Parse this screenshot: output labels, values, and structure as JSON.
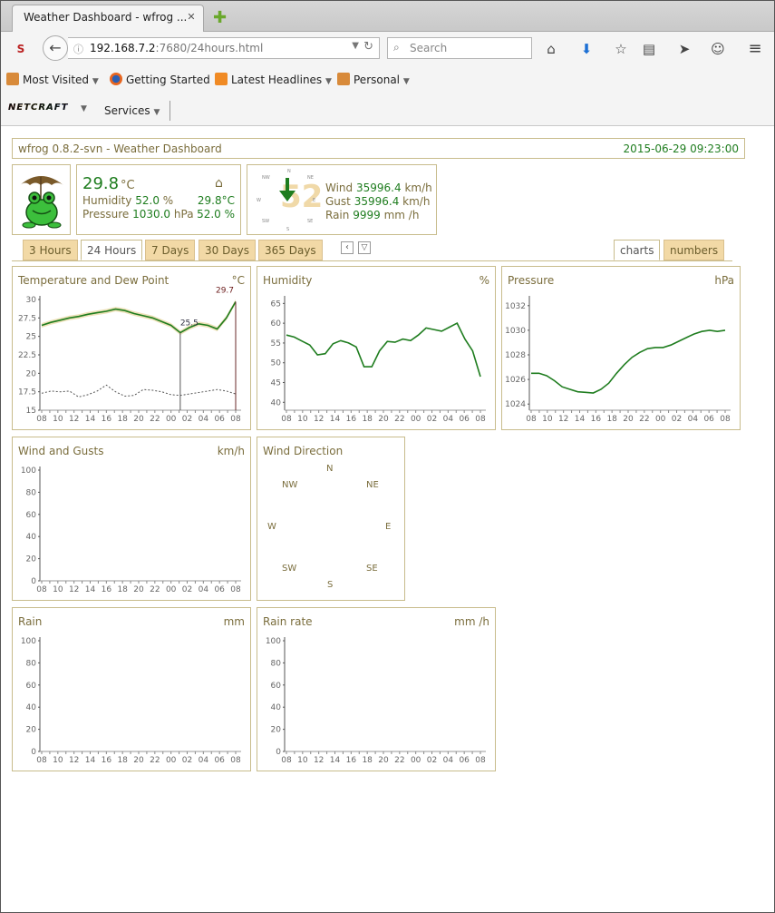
{
  "browser": {
    "tab_title": "Weather Dashboard - wfrog ...",
    "url_host": "192.168.7.2",
    "url_rest": ":7680/24hours.html",
    "search_placeholder": "Search",
    "bookmarks": [
      "Most Visited",
      "Getting Started",
      "Latest Headlines",
      "Personal"
    ],
    "netcraft_label": "NETCRAFT",
    "services_label": "Services"
  },
  "header": {
    "app_title": "wfrog 0.8.2-svn - Weather Dashboard",
    "datetime": "2015-06-29 09:23:00"
  },
  "current": {
    "temp": "29.8",
    "temp_unit": "°C",
    "humidity_label": "Humidity",
    "humidity": "52.0",
    "humidity_unit": "%",
    "pressure_label": "Pressure",
    "pressure": "1030.0",
    "pressure_unit": "hPa",
    "indoor_temp": "29.8°C",
    "indoor_hum": "52.0 %",
    "wind_label": "Wind",
    "wind": "35996.4",
    "wind_unit": "km/h",
    "gust_label": "Gust",
    "gust": "35996.4",
    "gust_unit": "km/h",
    "rain_label": "Rain",
    "rain": "9999",
    "rain_unit": "mm /h",
    "compass_value": "52"
  },
  "tabs": {
    "periods": [
      "3 Hours",
      "24 Hours",
      "7 Days",
      "30 Days",
      "365 Days"
    ],
    "active_period": "24 Hours",
    "views": [
      "charts",
      "numbers"
    ],
    "active_view": "charts"
  },
  "x_ticks": [
    "08",
    "10",
    "12",
    "14",
    "16",
    "18",
    "20",
    "22",
    "00",
    "02",
    "04",
    "06",
    "08"
  ],
  "compass_labels": {
    "N": "N",
    "NE": "NE",
    "E": "E",
    "SE": "SE",
    "S": "S",
    "SW": "SW",
    "W": "W",
    "NW": "NW"
  },
  "chart_data": [
    {
      "type": "line",
      "title": "Temperature and Dew Point",
      "unit": "°C",
      "ylim": [
        15,
        30
      ],
      "yticks": [
        "30",
        "27.5",
        "25",
        "22.5",
        "20",
        "17.5",
        "15"
      ],
      "series": [
        {
          "name": "temperature",
          "values": [
            26.5,
            26.9,
            27.2,
            27.5,
            27.7,
            28.0,
            28.2,
            28.4,
            28.7,
            28.5,
            28.1,
            27.8,
            27.5,
            27.0,
            26.5,
            25.5,
            26.2,
            26.7,
            26.5,
            26.0,
            27.5,
            29.7
          ]
        },
        {
          "name": "dew point",
          "values": [
            17.3,
            17.6,
            17.5,
            17.6,
            16.8,
            17.1,
            17.6,
            18.4,
            17.5,
            16.9,
            17.0,
            17.8,
            17.7,
            17.5,
            17.1,
            17.0,
            17.2,
            17.4,
            17.6,
            17.8,
            17.6,
            17.2
          ]
        }
      ],
      "annotations": [
        "25.5",
        "29.7"
      ]
    },
    {
      "type": "line",
      "title": "Humidity",
      "unit": "%",
      "ylim": [
        38,
        66
      ],
      "yticks": [
        "65",
        "60",
        "55",
        "50",
        "45",
        "40"
      ],
      "series": [
        {
          "name": "humidity",
          "values": [
            57,
            56.5,
            55.5,
            54.5,
            52,
            52.3,
            54.8,
            55.6,
            55,
            54,
            49,
            49,
            53,
            55.4,
            55.2,
            56,
            55.6,
            57,
            58.8,
            58.4,
            58,
            59,
            60,
            56,
            53,
            46.5
          ]
        }
      ]
    },
    {
      "type": "line",
      "title": "Pressure",
      "unit": "hPa",
      "ylim": [
        1023.5,
        1032.5
      ],
      "yticks": [
        "1032",
        "1030",
        "1028",
        "1026",
        "1024"
      ],
      "series": [
        {
          "name": "pressure",
          "values": [
            1026.5,
            1026.5,
            1026.3,
            1025.9,
            1025.4,
            1025.2,
            1025.0,
            1024.95,
            1024.9,
            1025.2,
            1025.7,
            1026.5,
            1027.2,
            1027.8,
            1028.2,
            1028.5,
            1028.6,
            1028.6,
            1028.8,
            1029.1,
            1029.4,
            1029.7,
            1029.9,
            1030.0,
            1029.9,
            1030.0
          ]
        }
      ]
    },
    {
      "type": "line",
      "title": "Wind and Gusts",
      "unit": "km/h",
      "ylim": [
        0,
        100
      ],
      "yticks": [
        "100",
        "80",
        "60",
        "40",
        "20",
        "0"
      ],
      "series": []
    },
    {
      "type": "line",
      "title": "Rain",
      "unit": "mm",
      "ylim": [
        0,
        100
      ],
      "yticks": [
        "100",
        "80",
        "60",
        "40",
        "20",
        "0"
      ],
      "series": []
    },
    {
      "type": "line",
      "title": "Rain rate",
      "unit": "mm /h",
      "ylim": [
        0,
        100
      ],
      "yticks": [
        "100",
        "80",
        "60",
        "40",
        "20",
        "0"
      ],
      "series": []
    }
  ],
  "wind_direction": {
    "title": "Wind Direction"
  },
  "colors": {
    "line_green": "#1f7d1f",
    "band": "#e8d9a6",
    "olive": "#7a6d3c",
    "border": "#c8bc8c"
  }
}
